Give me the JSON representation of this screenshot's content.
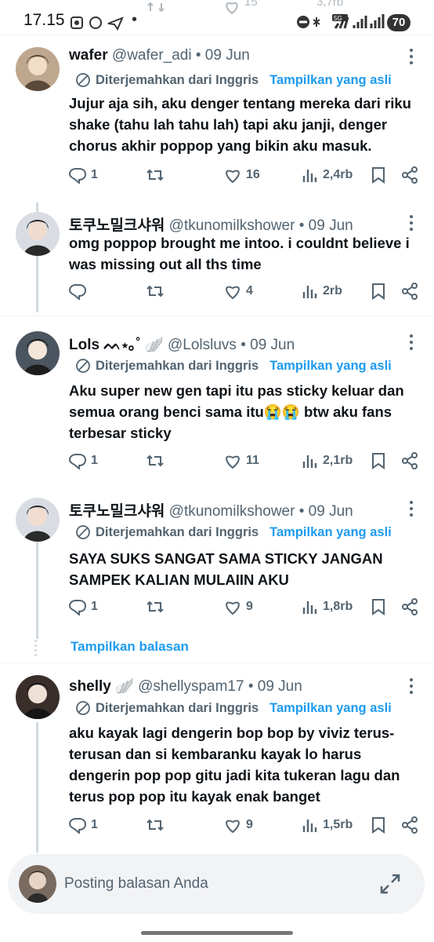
{
  "status_bar": {
    "time": "17.15",
    "battery": "70",
    "network": "5G"
  },
  "prev_tweet": {
    "likes": "15",
    "views": "3,7rb"
  },
  "colors": {
    "accent": "#1d9bf0",
    "text": "#0f1419",
    "muted": "#536471"
  },
  "translation": {
    "label": "Diterjemahkan dari Inggris",
    "show_original": "Tampilkan yang asli"
  },
  "tweets": [
    {
      "name": "wafer",
      "handle": "@wafer_adi",
      "date": "• 09 Jun",
      "translated": true,
      "text": "Jujur aja sih, aku denger tentang mereka dari riku shake (tahu lah tahu lah) tapi aku janji, denger chorus akhir poppop yang bikin aku masuk.",
      "replies": "1",
      "retweets": "",
      "likes": "16",
      "views": "2,4rb"
    },
    {
      "name": "토쿠노밀크샤워",
      "handle": "@tkunomilkshower",
      "date": "• 09 Jun",
      "translated": false,
      "text": "omg poppop brought me intoo. i couldnt believe i was missing out all ths time",
      "replies": "",
      "retweets": "",
      "likes": "4",
      "views": "2rb"
    },
    {
      "name": "Lols ᨓ⋆｡˚ 🪽",
      "handle": "@Lolsluvs",
      "date": "• 09 Jun",
      "translated": true,
      "text": "Aku super new gen tapi itu pas sticky keluar dan semua orang benci sama itu😭😭 btw aku fans terbesar sticky",
      "replies": "1",
      "retweets": "",
      "likes": "11",
      "views": "2,1rb"
    },
    {
      "name": "토쿠노밀크샤워",
      "handle": "@tkunomilkshower",
      "date": "• 09 Jun",
      "translated": true,
      "text": "SAYA SUKS SANGAT SAMA STICKY JANGAN SAMPEK KALIAN MULAIIN AKU",
      "replies": "1",
      "retweets": "",
      "likes": "9",
      "views": "1,8rb"
    },
    {
      "name": "shelly 🪽",
      "handle": "@shellyspam17",
      "date": "• 09 Jun",
      "translated": true,
      "text": "aku kayak lagi dengerin bop bop by viviz terus-terusan dan si kembaranku kayak lo harus dengerin pop pop gitu jadi kita tukeran lagu dan terus pop pop itu kayak enak banget",
      "replies": "1",
      "retweets": "",
      "likes": "9",
      "views": "1,5rb"
    }
  ],
  "show_replies": "Tampilkan balasan",
  "reply_bar": {
    "placeholder": "Posting balasan Anda"
  }
}
